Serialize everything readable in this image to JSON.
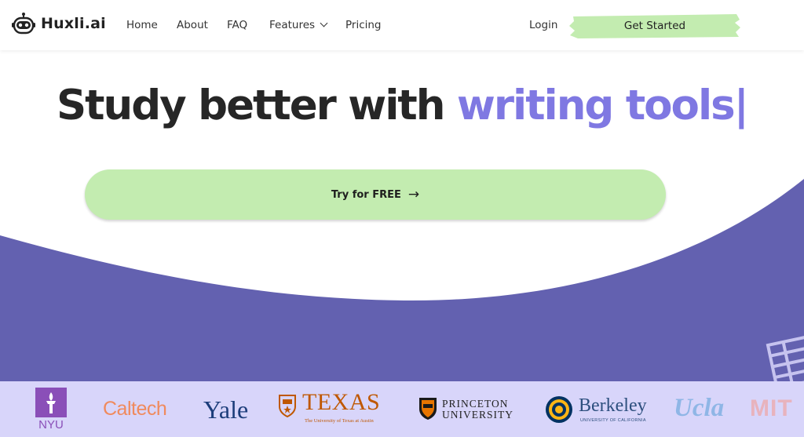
{
  "brand": {
    "name": "Huxli.ai"
  },
  "nav": {
    "items": [
      {
        "label": "Home"
      },
      {
        "label": "About"
      },
      {
        "label": "FAQ"
      },
      {
        "label": "Features"
      },
      {
        "label": "Pricing"
      }
    ],
    "login": "Login",
    "get_started": "Get Started"
  },
  "hero": {
    "title_plain": "Study better with ",
    "title_accent": "writing tools|",
    "cta": "Try for FREE"
  },
  "universities": {
    "nyu": "NYU",
    "caltech": "Caltech",
    "yale": "Yale",
    "texas": "TEXAS",
    "texas_sub": "The University of Texas at Austin",
    "princeton_1": "PRINCETON",
    "princeton_2": "UNIVERSITY",
    "berkeley": "Berkeley",
    "berkeley_sub": "UNIVERSITY OF CALIFORNIA",
    "ucla": "Ucla",
    "mit": "MIT"
  },
  "colors": {
    "accent": "#7f78e2",
    "wave": "#6361b0",
    "cta_green": "#c3ecb0",
    "logo_band": "#d8d5fa"
  }
}
